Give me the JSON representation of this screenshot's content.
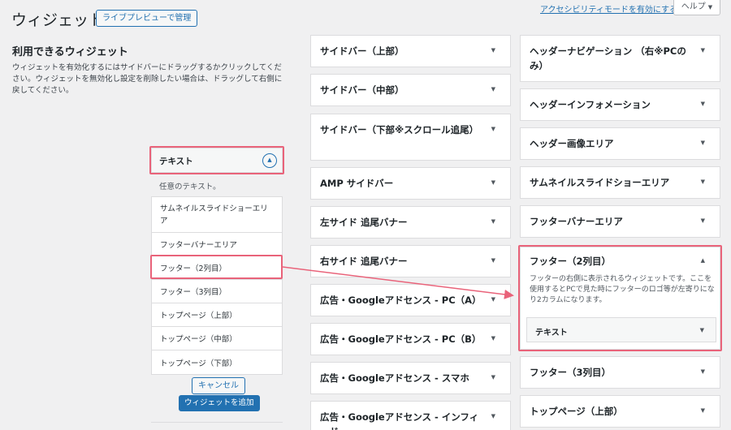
{
  "header": {
    "title": "ウィジェット",
    "live_preview_label": "ライブプレビューで管理",
    "a11y_link": "アクセシビリティモードを有効にする",
    "help_label": "ヘルプ",
    "help_icon": "triangle-down-icon"
  },
  "available": {
    "heading": "利用できるウィジェット",
    "description": "ウィジェットを有効化するにはサイドバーにドラッグするかクリックしてください。ウィジェットを無効化し設定を削除したい場合は、ドラッグして右側に戻してください。"
  },
  "text_widget": {
    "title": "テキスト",
    "toggle_icon": "chevron-up-circle-icon",
    "description": "任意のテキスト。",
    "targets": [
      "サムネイルスライドショーエリア",
      "フッターバナーエリア",
      "フッター（2列目）",
      "フッター（3列目）",
      "トップページ（上部）",
      "トップページ（中部）",
      "トップページ（下部）"
    ],
    "cancel_label": "キャンセル",
    "add_label": "ウィジェットを追加"
  },
  "areas_col1": [
    "サイドバー（上部）",
    "サイドバー（中部）",
    "サイドバー（下部※スクロール追尾）",
    "AMP サイドバー",
    "左サイド 追尾バナー",
    "右サイド 追尾バナー",
    "広告・Googleアドセンス - PC（A）",
    "広告・Googleアドセンス - PC（B）",
    "広告・Googleアドセンス - スマホ",
    "広告・Googleアドセンス - インフィード"
  ],
  "areas_col2": [
    "ヘッダーナビゲーション （右※PCのみ）",
    "ヘッダーインフォメーション",
    "ヘッダー画像エリア",
    "サムネイルスライドショーエリア",
    "フッターバナーエリア"
  ],
  "footer2": {
    "title": "フッター（2列目）",
    "description": "フッターの右側に表示されるウィジェットです。ここを使用するとPCで見た時にフッターのロゴ等が左寄りになり2カラムになります。",
    "widget_title": "テキスト"
  },
  "areas_col2_after": [
    "フッター（3列目）",
    "トップページ（上部）"
  ],
  "colors": {
    "highlight": "#e9637a",
    "accent": "#2271b1"
  }
}
